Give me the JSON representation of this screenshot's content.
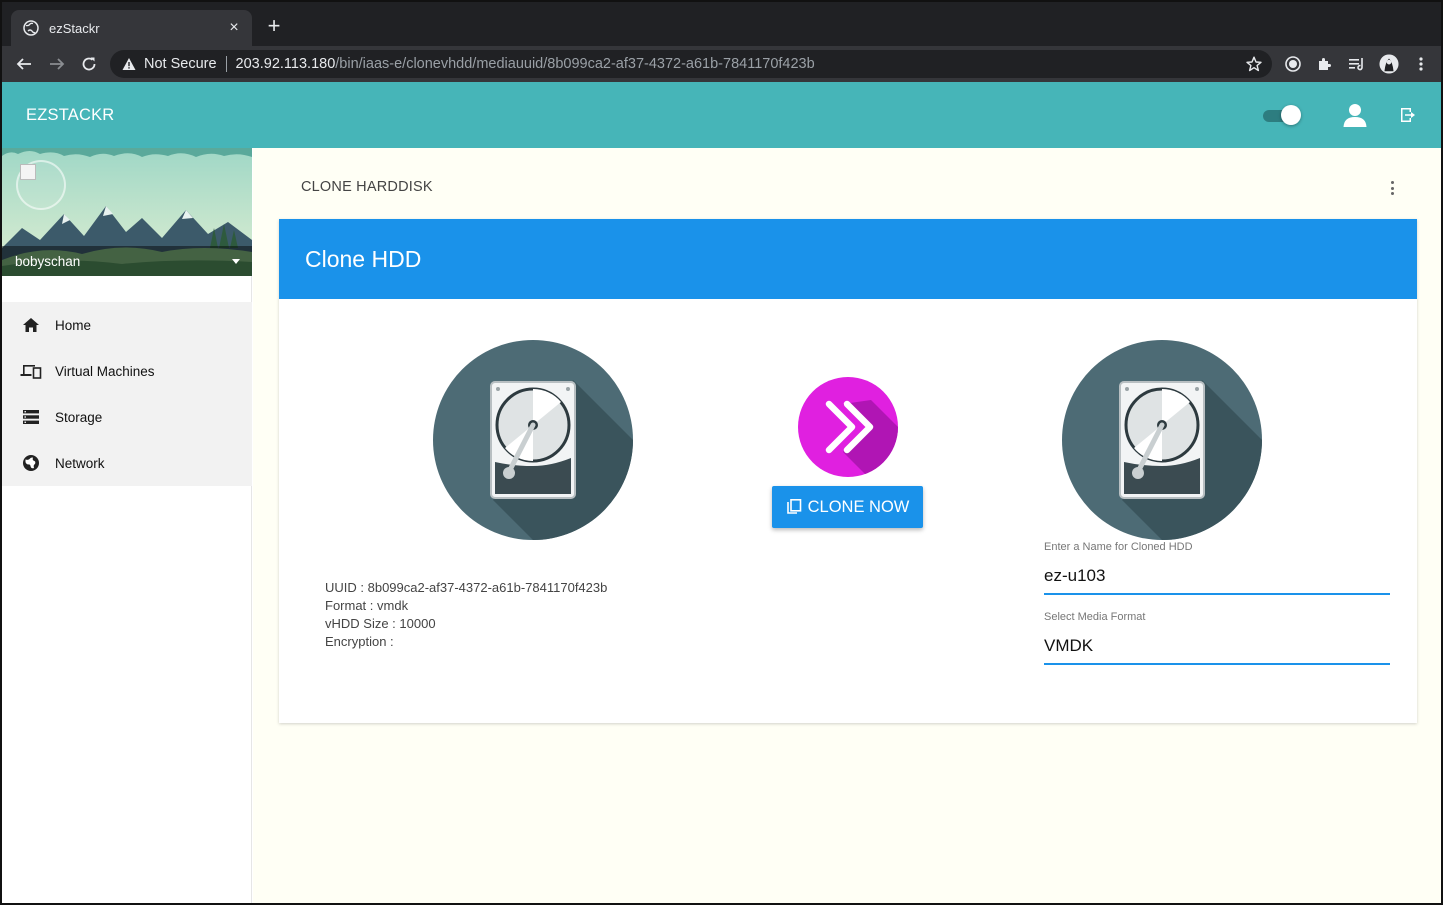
{
  "browser": {
    "tab_title": "ezStackr",
    "tab_close": "×",
    "new_tab": "+",
    "security_label": "Not Secure",
    "url_host": "203.92.113.180",
    "url_path": "/bin/iaas-e/clonevhdd/mediauuid/8b099ca2-af37-4372-a61b-7841170f423b"
  },
  "header": {
    "brand": "EZSTACKR"
  },
  "sidebar": {
    "username": "bobyschan",
    "items": [
      {
        "label": "Home",
        "icon": "home-icon"
      },
      {
        "label": "Virtual Machines",
        "icon": "devices-icon"
      },
      {
        "label": "Storage",
        "icon": "storage-icon"
      },
      {
        "label": "Network",
        "icon": "globe-icon"
      }
    ]
  },
  "main": {
    "page_title": "CLONE HARDDISK",
    "card_title": "Clone HDD",
    "clone_button_label": "CLONE NOW",
    "info": {
      "uuid": "UUID : 8b099ca2-af37-4372-a61b-7841170f423b",
      "format": "Format : vmdk",
      "size": "vHDD Size : 10000",
      "encryption": "Encryption :"
    },
    "name_field": {
      "label": "Enter a Name for Cloned HDD",
      "value": "ez-u103"
    },
    "format_field": {
      "label": "Select Media Format",
      "value": "VMDK"
    }
  },
  "colors": {
    "appbar": "#46b5b8",
    "card_header": "#1a92ea",
    "clone_arrow": "#e020e0",
    "disk_circle": "#4d6b75"
  }
}
